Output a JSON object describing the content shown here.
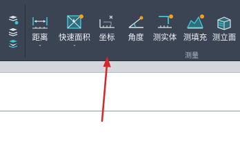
{
  "ribbon": {
    "tools": [
      {
        "label": "距离",
        "icon": "distance-icon",
        "has_dropdown": true
      },
      {
        "label": "快速面积",
        "icon": "quick-area-icon",
        "has_dropdown": true
      },
      {
        "label": "坐标",
        "icon": "coordinate-icon",
        "has_dropdown": false
      },
      {
        "label": "角度",
        "icon": "angle-icon",
        "has_dropdown": false
      },
      {
        "label": "测实体",
        "icon": "measure-entity-icon",
        "has_dropdown": false
      },
      {
        "label": "测填充",
        "icon": "measure-hatch-icon",
        "has_dropdown": false
      },
      {
        "label": "测立面",
        "icon": "measure-elevation-icon",
        "has_dropdown": false
      }
    ],
    "group_label": "测量",
    "dropdown_glyph": "⌄"
  },
  "colors": {
    "ribbon_bg": "#3b4453",
    "icon_cyan": "#3fc6dd",
    "badge_orange": "#f2a01e",
    "arrow_red": "#d42a2a"
  }
}
